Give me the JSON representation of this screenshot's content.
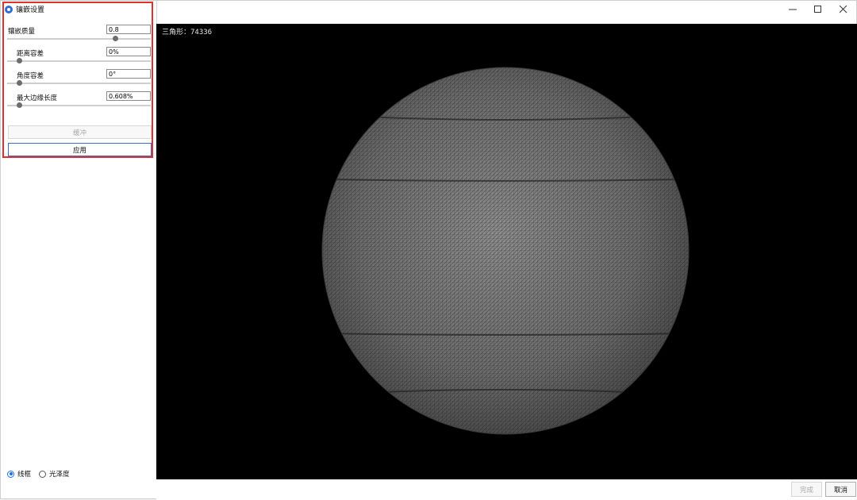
{
  "panel": {
    "title": "镶嵌设置",
    "quality": {
      "label": "镶嵌质量",
      "value": "0.8",
      "slider_fraction": 0.8
    },
    "distance_tolerance": {
      "label": "距离容差",
      "value": "0%",
      "slider_fraction": 0
    },
    "angle_tolerance": {
      "label": "角度容差",
      "value": "0°",
      "slider_fraction": 0
    },
    "max_edge_length": {
      "label": "最大边缘长度",
      "value": "0.608%",
      "slider_fraction": 0
    },
    "reset_button": "缓冲",
    "apply_button": "应用"
  },
  "view_mode": {
    "options": [
      {
        "label": "线框",
        "checked": true
      },
      {
        "label": "光泽度",
        "checked": false
      }
    ]
  },
  "viewport": {
    "triangle_count": "三角形：74336"
  },
  "footer": {
    "done_button": "完成",
    "cancel_button": "取消"
  },
  "colors": {
    "highlight_border": "#e03131",
    "accent": "#1a73e8",
    "viewport_bg": "#000000"
  }
}
